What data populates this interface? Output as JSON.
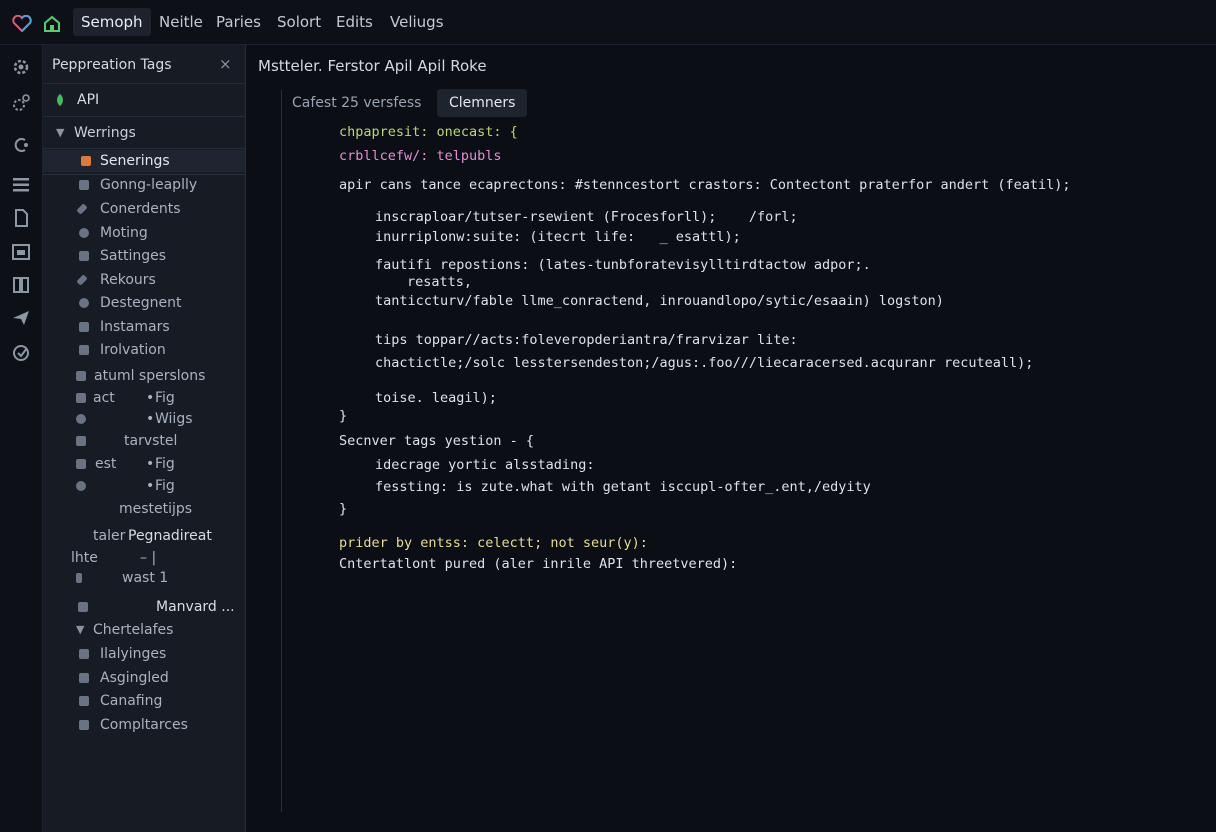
{
  "menubar": {
    "items": [
      "Semoph",
      "Neitle",
      "Paries",
      "Solort",
      "Edits",
      "Veliugs"
    ]
  },
  "sidebar": {
    "title": "Pepprеation Tags",
    "close": "×",
    "items": [
      {
        "label": "API"
      },
      {
        "label": "Werrings"
      },
      {
        "label": "Senerings"
      },
      {
        "label": "Gonng-leaplly"
      },
      {
        "label": "Conerdents"
      },
      {
        "label": "Moting"
      },
      {
        "label": "Sattinges"
      },
      {
        "label": "Rekours"
      },
      {
        "label": "Destegnent"
      },
      {
        "label": "Instamars"
      },
      {
        "label": "Irolvation"
      },
      {
        "label": "atuml sperslons"
      },
      {
        "label": "act",
        "right": "Fig"
      },
      {
        "label": "",
        "right": "Wiigs"
      },
      {
        "label": "tarvstel"
      },
      {
        "label": "est",
        "right": "Fig"
      },
      {
        "label": "",
        "right": "Fig"
      },
      {
        "label": "mestetijps"
      },
      {
        "label": "taler",
        "right": "Pegnadireat"
      },
      {
        "label": "lhte",
        "right": "– |"
      },
      {
        "label": "wast 1"
      },
      {
        "label": "",
        "right": "Manvard ..."
      },
      {
        "label": "Chertelafes"
      },
      {
        "label": "Ilalyinges"
      },
      {
        "label": "Asgingled"
      },
      {
        "label": "Canafing"
      },
      {
        "label": "Compltarces"
      }
    ]
  },
  "editor": {
    "breadcrumb": "Mstteler.  Ferstor Apil Apil Roke",
    "tabs": [
      "Cafest 25 versfess",
      "Clemners"
    ],
    "code": [
      {
        "text": "chpapresit: onecast: {",
        "color": "c-green"
      },
      {
        "text": "crbllcefw/: telpubls",
        "color": "c-pink"
      },
      {
        "text": "apir cans tance ecaprectons: #stenncestort crastors: Contectont praterfor andert (featil);",
        "color": "c-white"
      },
      {
        "text": "inscraploar/tutser-rsewient (Frocesforll);    /forl;",
        "color": "c-white"
      },
      {
        "text": "inurriplonw:suite: (itecrt life:   _ esattl);",
        "color": "c-white"
      },
      {
        "text": "fautifi repostions: (lates-tunbforatevisylltirdtactow adpor;.",
        "color": "c-white"
      },
      {
        "text": "resatts,",
        "color": "c-white"
      },
      {
        "text": "tanticcturv/fable llme_conractend, inrouandlopo/sytic/esaain) logston)",
        "color": "c-white"
      },
      {
        "text": "tips toppar//acts:foleveropderiantra/frarvizar lite:",
        "color": "c-white"
      },
      {
        "text": "chactictle;/solc lesstersendeston;/agus:.foo///liecaracersed.acquranr recuteall);",
        "color": "c-white"
      },
      {
        "text": "toise. leagil);",
        "color": "c-white"
      },
      {
        "text": "}",
        "color": "c-white"
      },
      {
        "text": "Secnver tags yestion - {",
        "color": "c-white"
      },
      {
        "text": "idecrage yortic alsstading:",
        "color": "c-white"
      },
      {
        "text": "fessting: is zute.what with getant isccupl-ofter_.ent,/edyity",
        "color": "c-white"
      },
      {
        "text": "}",
        "color": "c-white"
      },
      {
        "text": "prider by entss: celectt; not seur(y):",
        "color": "c-yellow"
      },
      {
        "text": "Cntertatlont pured (aler inrile API threetvered):",
        "color": "c-white"
      }
    ]
  },
  "colors": {
    "background": "#0b0e14",
    "sidebar": "#171c24",
    "accent_green": "#b9d86d",
    "accent_pink": "#e58fd3",
    "accent_cyan": "#6fd3e6"
  }
}
